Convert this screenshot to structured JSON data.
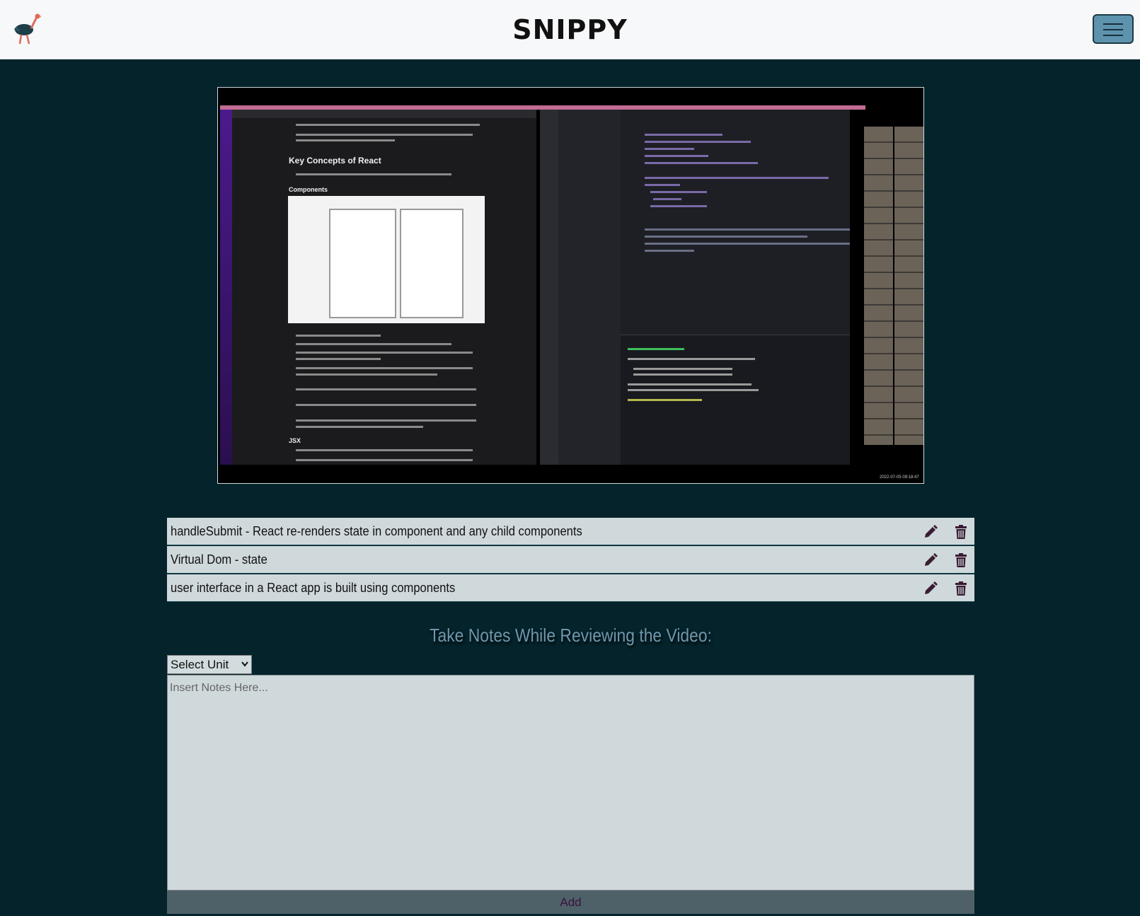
{
  "header": {
    "brand": "SNIPPY",
    "logo_icon": "ostrich-logo-icon",
    "menu_icon": "hamburger-menu-icon"
  },
  "video": {
    "doc_heading": "Key Concepts of React",
    "doc_subheading": "Components",
    "doc_section": "JSX",
    "timestamp": "2022-07-05 09:18:47"
  },
  "notes": [
    {
      "text": "handleSubmit - React re-renders state in component and any child components",
      "edit_icon": "pencil-icon",
      "delete_icon": "trash-icon"
    },
    {
      "text": "Virtual Dom - state",
      "edit_icon": "pencil-icon",
      "delete_icon": "trash-icon"
    },
    {
      "text": "user interface in a React app is built using components",
      "edit_icon": "pencil-icon",
      "delete_icon": "trash-icon"
    }
  ],
  "form": {
    "title": "Take Notes While Reviewing the Video:",
    "unit_select": "Select Unit",
    "notes_placeholder": "Insert Notes Here...",
    "add_label": "Add"
  },
  "colors": {
    "background": "#04232b",
    "navbar": "#f7f8f9",
    "menu_button": "#5e93ad",
    "note_row": "#cfd9db",
    "title_text": "#6f97ad",
    "icon": "#3a1b34"
  }
}
